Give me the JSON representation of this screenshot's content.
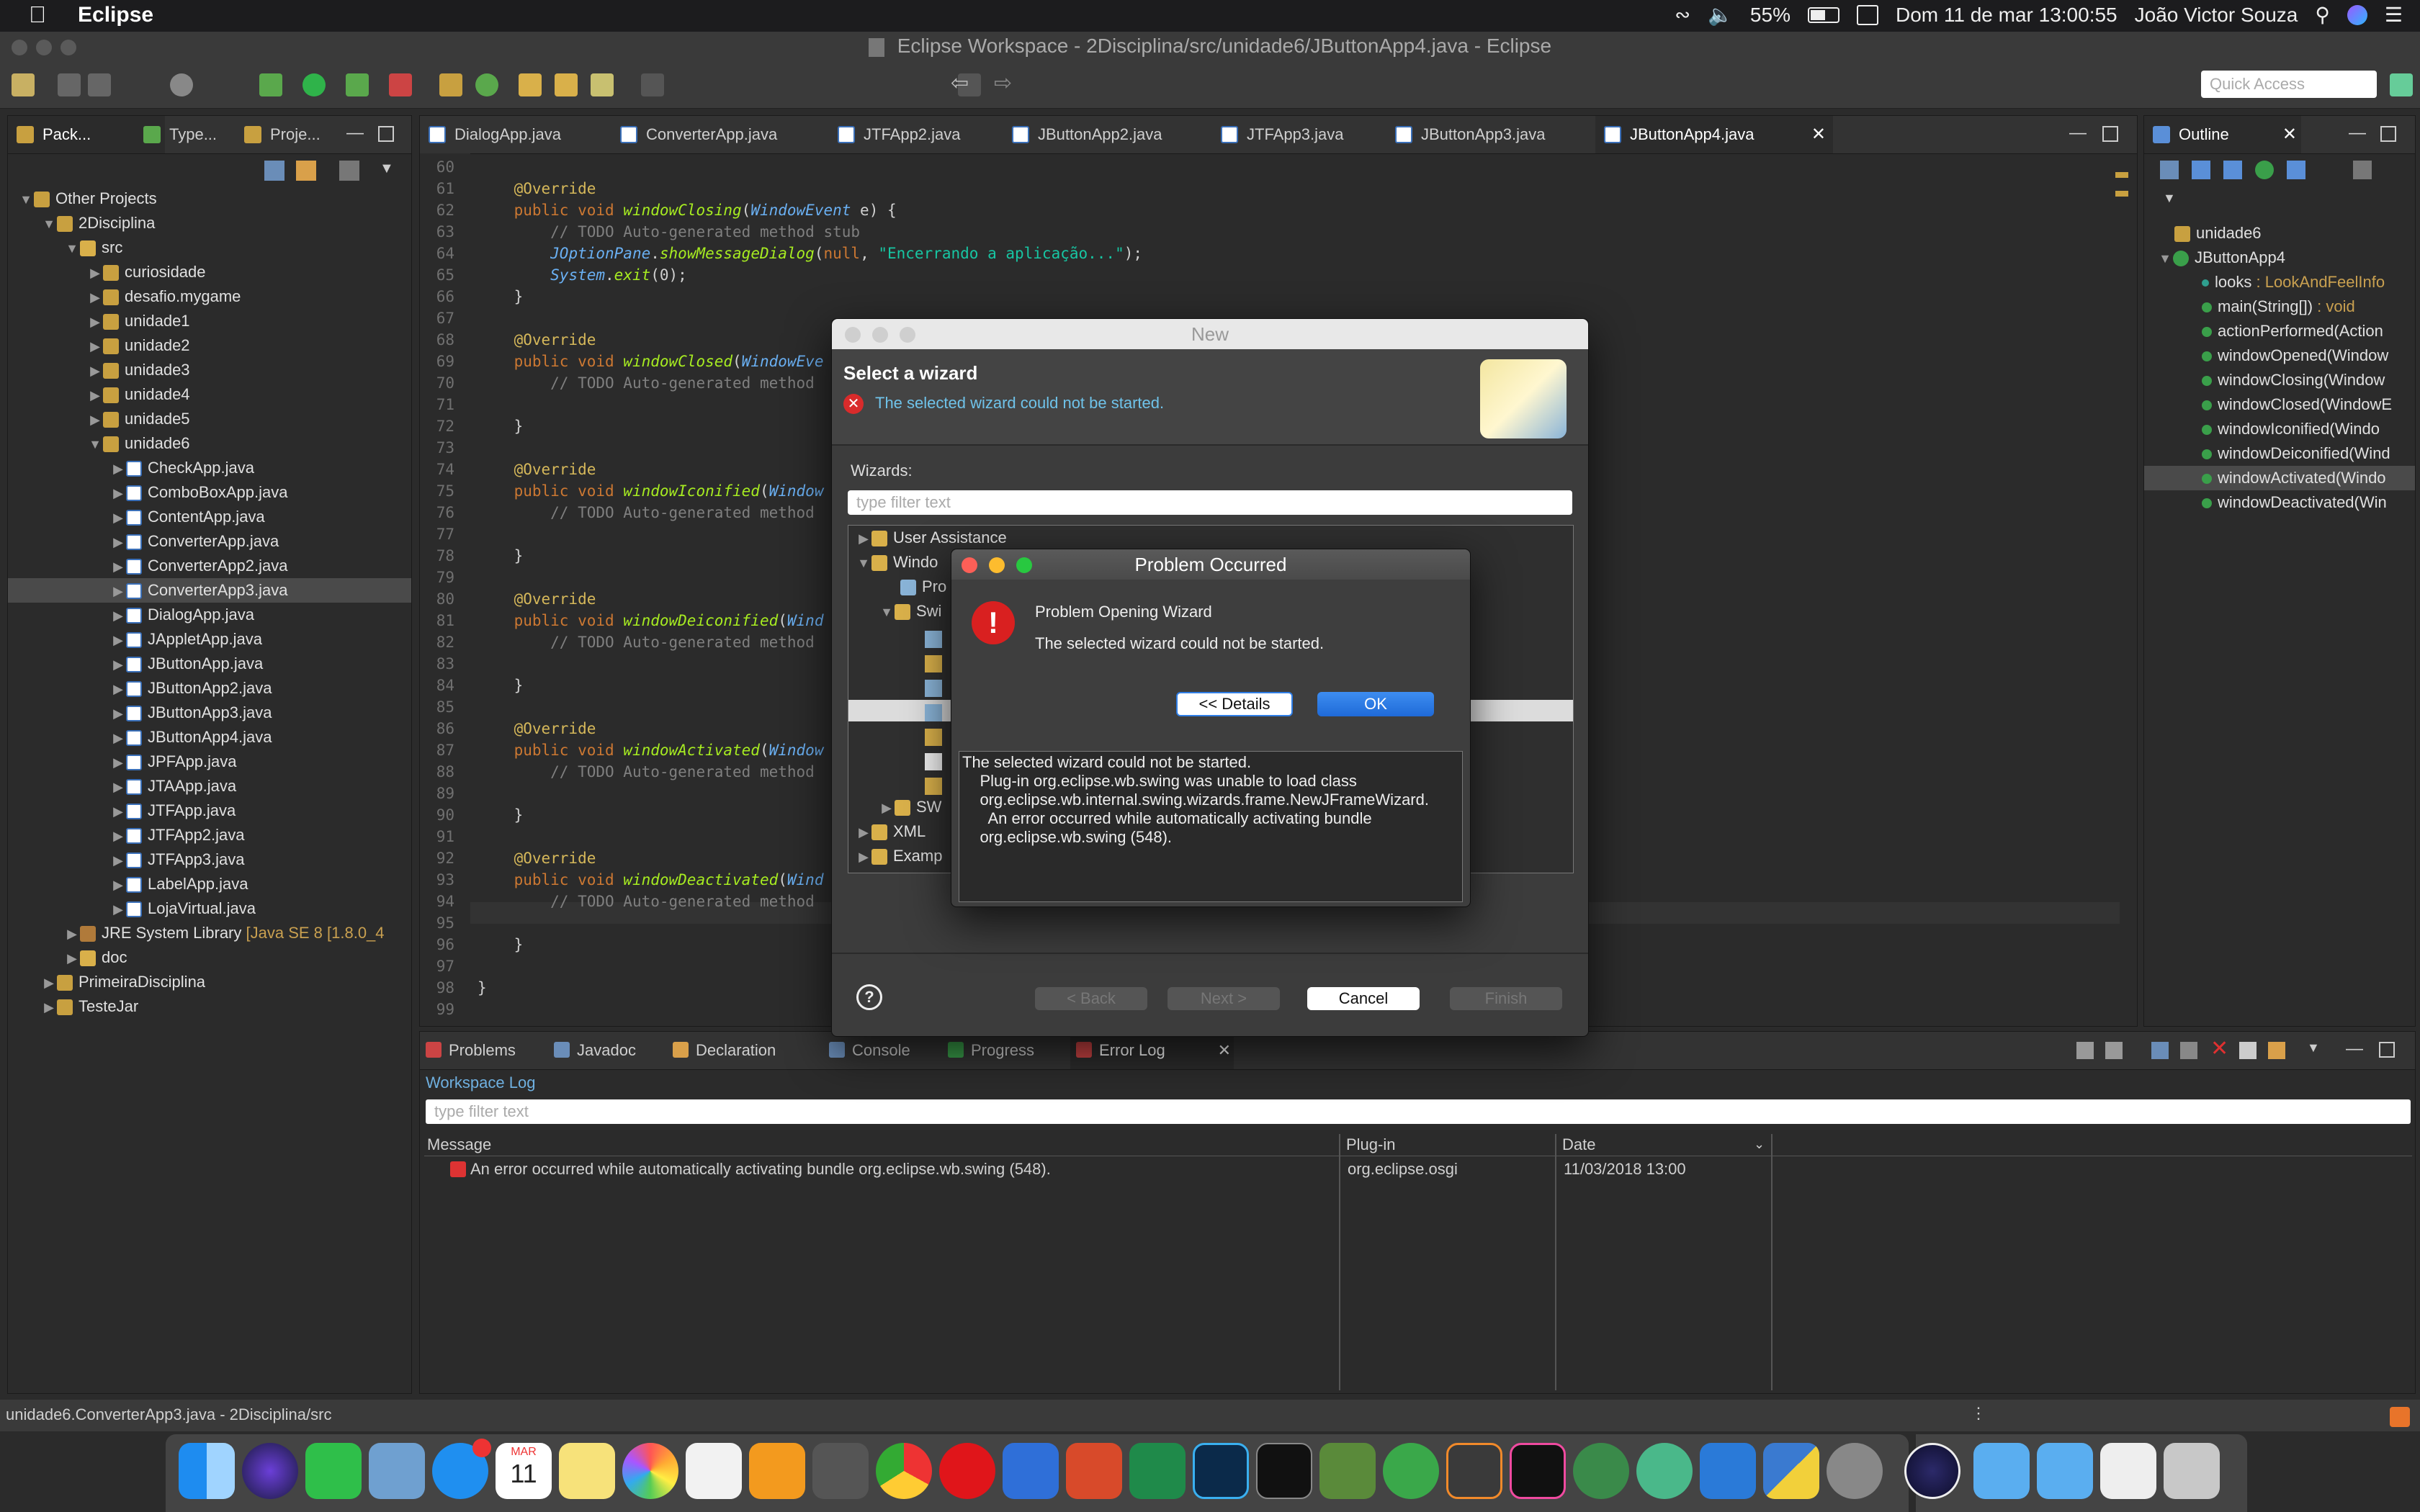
{
  "menubar": {
    "app_name": "Eclipse",
    "battery": "55%",
    "datetime": "Dom 11 de mar  13:00:55",
    "user": "João Victor Souza"
  },
  "window": {
    "title": "Eclipse Workspace - 2Disciplina/src/unidade6/JButtonApp4.java - Eclipse",
    "quick_access_placeholder": "Quick Access"
  },
  "left_tabs": [
    "Pack...",
    "Type...",
    "Proje..."
  ],
  "tree": {
    "root": "Other Projects",
    "project": "2Disciplina",
    "src": "src",
    "packages": [
      "curiosidade",
      "desafio.mygame",
      "unidade1",
      "unidade2",
      "unidade3",
      "unidade4",
      "unidade5",
      "unidade6"
    ],
    "files": [
      "CheckApp.java",
      "ComboBoxApp.java",
      "ContentApp.java",
      "ConverterApp.java",
      "ConverterApp2.java",
      "ConverterApp3.java",
      "DialogApp.java",
      "JAppletApp.java",
      "JButtonApp.java",
      "JButtonApp2.java",
      "JButtonApp3.java",
      "JButtonApp4.java",
      "JPFApp.java",
      "JTAApp.java",
      "JTFApp.java",
      "JTFApp2.java",
      "JTFApp3.java",
      "LabelApp.java",
      "LojaVirtual.java"
    ],
    "selected_file": "ConverterApp3.java",
    "jre": "JRE System Library",
    "jre_version": "[Java SE 8 [1.8.0_4",
    "doc": "doc",
    "other_projects": [
      "PrimeiraDisciplina",
      "TesteJar"
    ]
  },
  "editor_tabs": [
    "DialogApp.java",
    "ConverterApp.java",
    "JTFApp2.java",
    "JButtonApp2.java",
    "JTFApp3.java",
    "JButtonApp3.java",
    "JButtonApp4.java"
  ],
  "active_editor_tab": "JButtonApp4.java",
  "code": {
    "line_numbers": [
      "60",
      "61",
      "62",
      "63",
      "64",
      "65",
      "66",
      "67",
      "68",
      "69",
      "70",
      "71",
      "72",
      "73",
      "74",
      "75",
      "76",
      "77",
      "78",
      "79",
      "80",
      "81",
      "82",
      "83",
      "84",
      "85",
      "86",
      "87",
      "88",
      "89",
      "90",
      "91",
      "92",
      "93",
      "94",
      "95",
      "96",
      "97",
      "98",
      "99"
    ],
    "override": "@Override",
    "l62": [
      "public void ",
      "windowClosing",
      "(",
      "WindowEvent",
      " e) {"
    ],
    "todo": "// TODO Auto-generated method stub",
    "todo_cut": "// TODO Auto-generated method",
    "l64": [
      "JOptionPane",
      ".",
      "showMessageDialog",
      "(",
      "null",
      ", ",
      "\"Encerrando a aplicação...\"",
      ");"
    ],
    "l65": [
      "System",
      ".",
      "exit",
      "(0);"
    ],
    "close": "}",
    "l69": [
      "public void ",
      "windowClosed",
      "(",
      "WindowEve"
    ],
    "l75": [
      "public void ",
      "windowIconified",
      "(",
      "Window"
    ],
    "l81": [
      "public void ",
      "windowDeiconified",
      "(",
      "Wind"
    ],
    "l87": [
      "public void ",
      "windowActivated",
      "(",
      "Window"
    ],
    "l93": [
      "public void ",
      "windowDeactivated",
      "(",
      "Wind"
    ]
  },
  "outline": {
    "tab": "Outline",
    "package": "unidade6",
    "class": "JButtonApp4",
    "field": "looks",
    "field_type": ": LookAndFeelInfo",
    "main": "main(String[])",
    "main_type": ": void",
    "methods": [
      "actionPerformed(Action",
      "windowOpened(Window",
      "windowClosing(Window",
      "windowClosed(WindowE",
      "windowIconified(Windo",
      "windowDeiconified(Wind",
      "windowActivated(Windo",
      "windowDeactivated(Win"
    ],
    "selected_method": "windowActivated(Windo"
  },
  "wizard": {
    "title": "New",
    "heading": "Select a wizard",
    "error": "The selected wizard could not be started.",
    "wizards_label": "Wizards:",
    "filter_placeholder": "type filter text",
    "items": [
      "User Assistance",
      "Windo",
      "Pro",
      "Swi",
      "SW",
      "XML",
      "Examp"
    ],
    "back": "< Back",
    "next": "Next >",
    "cancel": "Cancel",
    "finish": "Finish"
  },
  "problem": {
    "title": "Problem Occurred",
    "heading": "Problem Opening Wizard",
    "message": "The selected wizard could not be started.",
    "details_button": "<< Details",
    "ok_button": "OK",
    "details": [
      "The selected wizard could not be started.",
      "    Plug-in org.eclipse.wb.swing was unable to load class",
      "    org.eclipse.wb.internal.swing.wizards.frame.NewJFrameWizard.",
      "      An error occurred while automatically activating bundle",
      "    org.eclipse.wb.swing (548)."
    ]
  },
  "bottom_tabs": [
    "Problems",
    "Javadoc",
    "Declaration",
    "Console",
    "Progress",
    "Error Log"
  ],
  "active_bottom_tab": "Error Log",
  "errorlog": {
    "title": "Workspace Log",
    "filter_placeholder": "type filter text",
    "col_message": "Message",
    "col_plugin": "Plug-in",
    "col_date": "Date",
    "rows": [
      {
        "message": "An error occurred while automatically activating bundle org.eclipse.wb.swing (548).",
        "plugin": "org.eclipse.osgi",
        "date": "11/03/2018 13:00"
      }
    ]
  },
  "statusbar": {
    "text": "unidade6.ConverterApp3.java - 2Disciplina/src"
  },
  "colors": {
    "accent_blue": "#2f7ee6",
    "error_red": "#d92b2b",
    "tree_selection": "#4a4a4a"
  },
  "dock_calendar": {
    "month": "MAR",
    "day": "11"
  }
}
